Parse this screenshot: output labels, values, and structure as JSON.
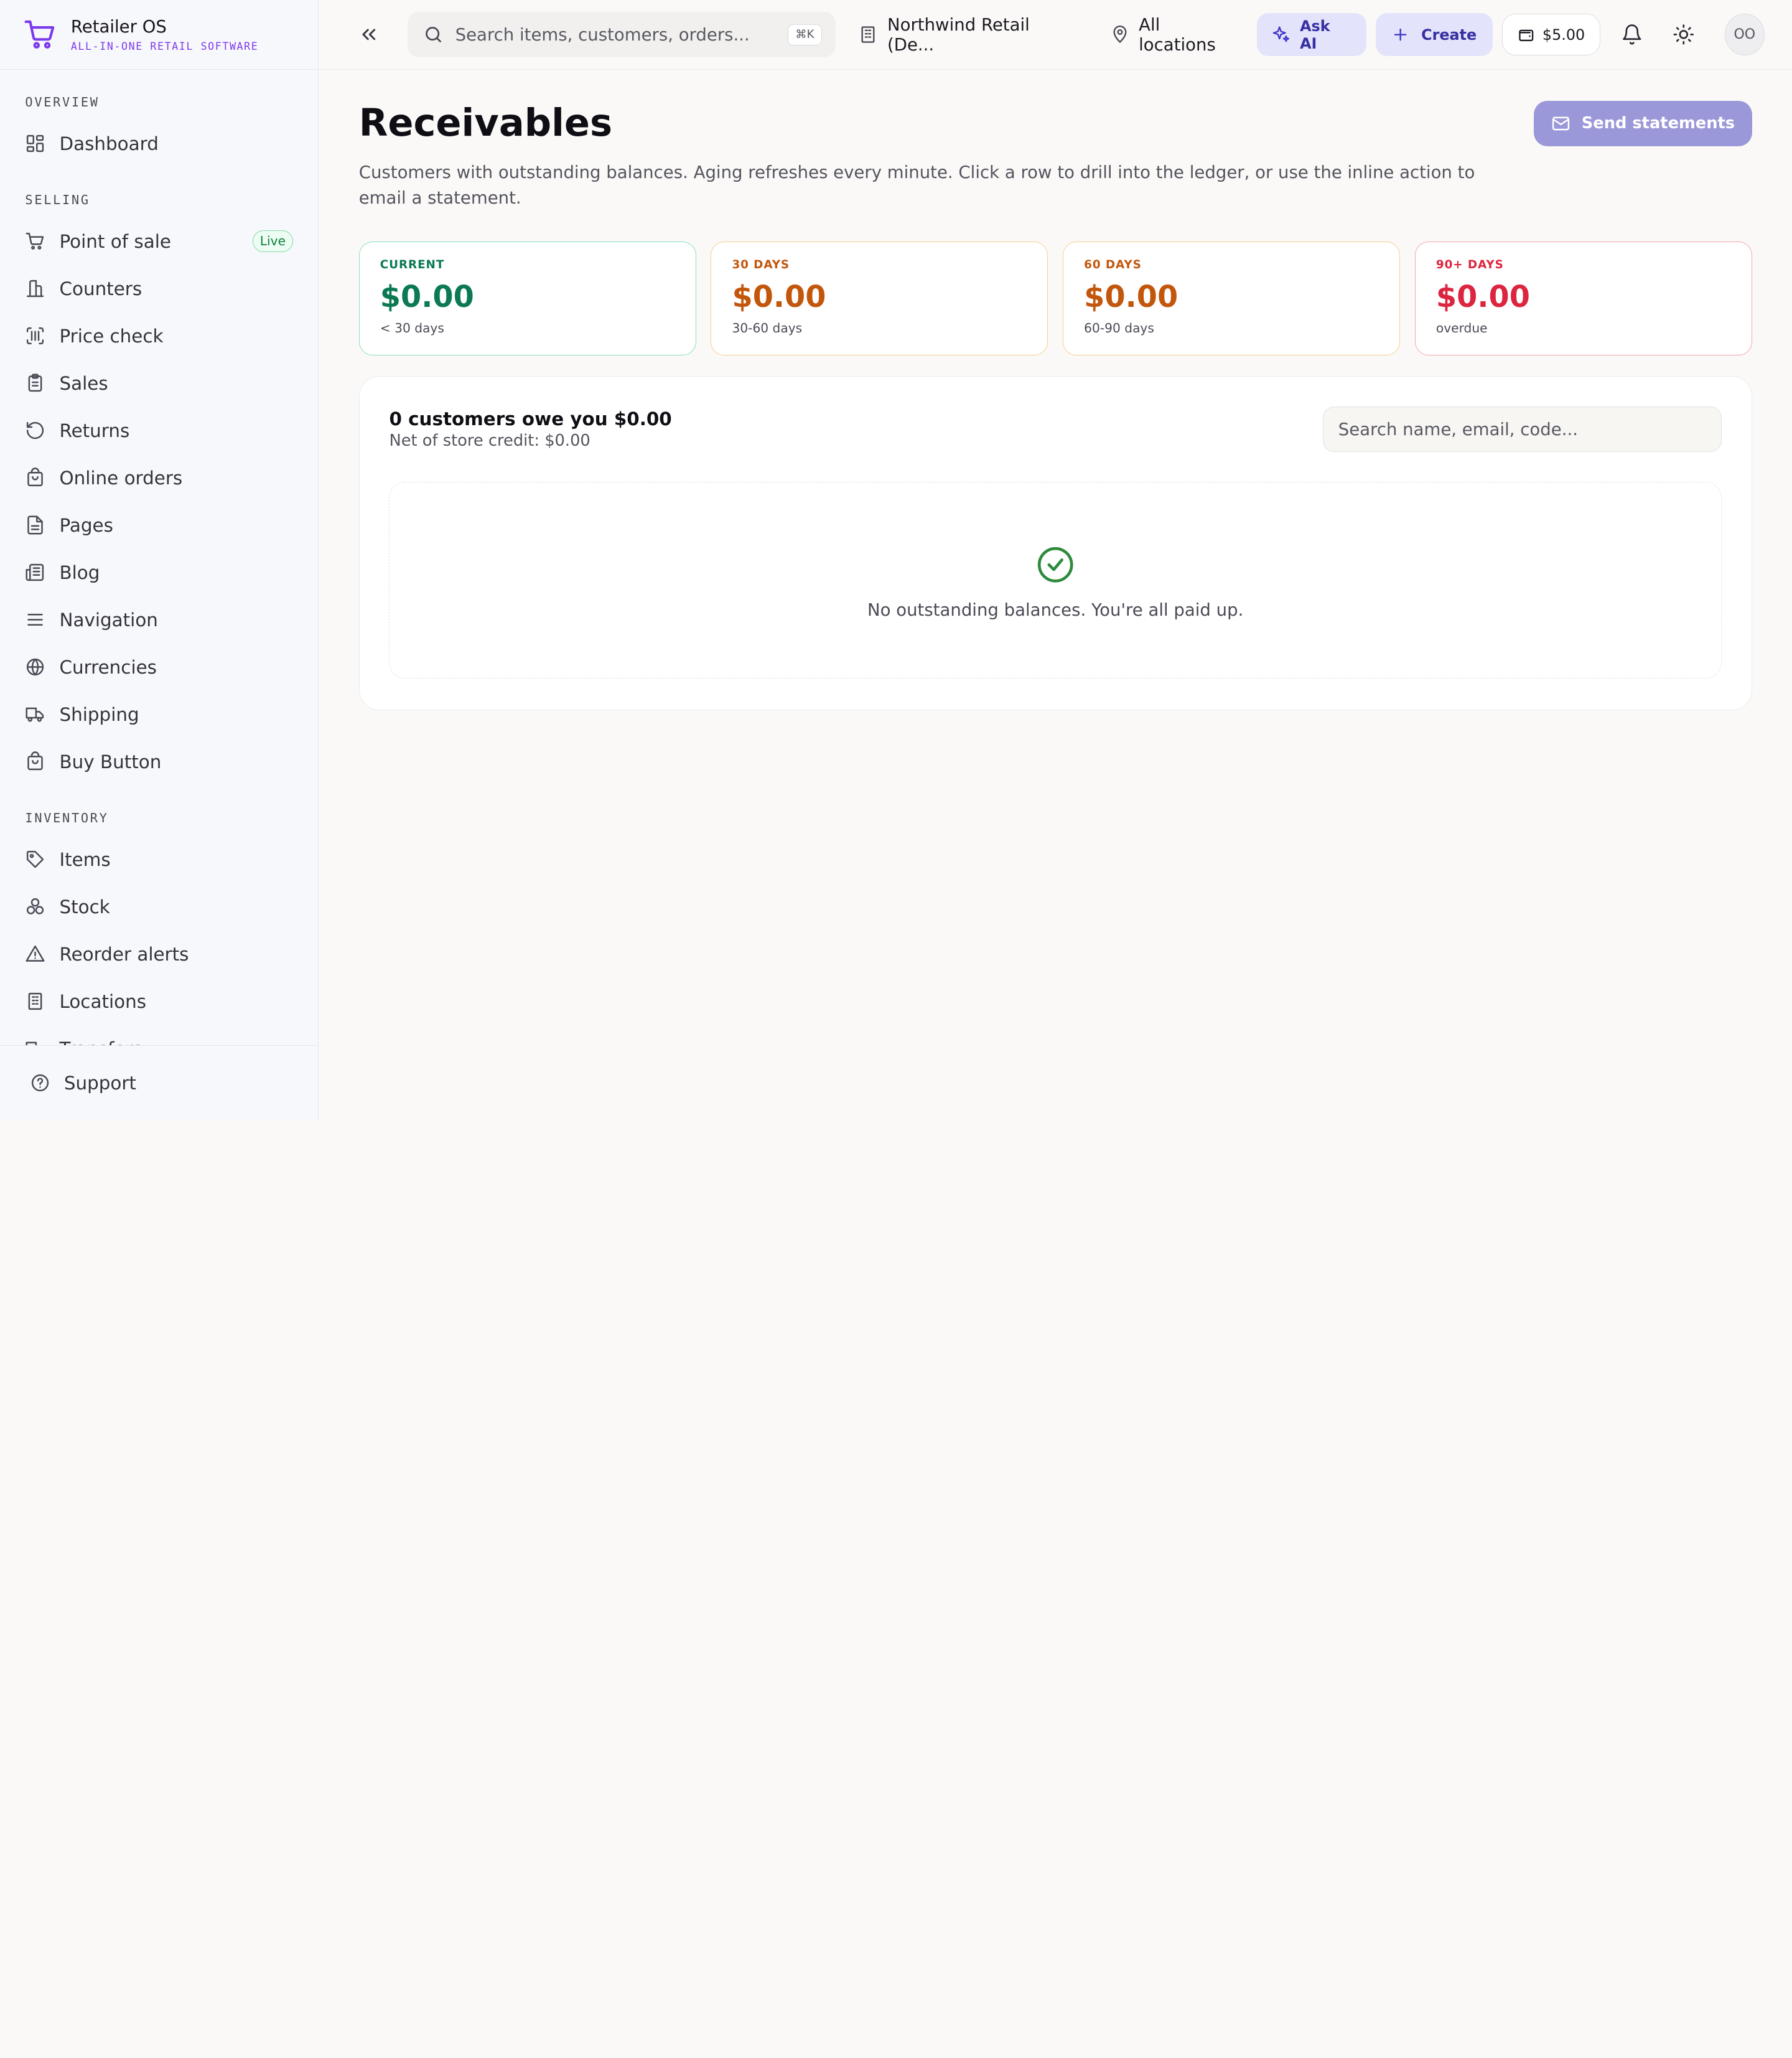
{
  "brand": {
    "name": "Retailer OS",
    "tagline": "ALL-IN-ONE RETAIL SOFTWARE"
  },
  "sidebar": {
    "sections": [
      {
        "title": "OVERVIEW",
        "items": [
          {
            "label": "Dashboard",
            "icon": "dashboard-icon"
          }
        ]
      },
      {
        "title": "SELLING",
        "items": [
          {
            "label": "Point of sale",
            "icon": "cart-icon",
            "badge": "Live"
          },
          {
            "label": "Counters",
            "icon": "counter-icon"
          },
          {
            "label": "Price check",
            "icon": "barcode-icon"
          },
          {
            "label": "Sales",
            "icon": "clipboard-icon"
          },
          {
            "label": "Returns",
            "icon": "returns-icon"
          },
          {
            "label": "Online orders",
            "icon": "bag-icon"
          },
          {
            "label": "Pages",
            "icon": "page-icon"
          },
          {
            "label": "Blog",
            "icon": "newspaper-icon"
          },
          {
            "label": "Navigation",
            "icon": "menu-icon"
          },
          {
            "label": "Currencies",
            "icon": "globe-icon"
          },
          {
            "label": "Shipping",
            "icon": "truck-icon"
          },
          {
            "label": "Buy Button",
            "icon": "bag-icon"
          }
        ]
      },
      {
        "title": "INVENTORY",
        "items": [
          {
            "label": "Items",
            "icon": "tag-icon"
          },
          {
            "label": "Stock",
            "icon": "boxes-icon"
          },
          {
            "label": "Reorder alerts",
            "icon": "alert-icon"
          },
          {
            "label": "Locations",
            "icon": "building-icon"
          },
          {
            "label": "Transfers",
            "icon": "truck-icon"
          }
        ]
      }
    ],
    "footer": {
      "label": "Support",
      "icon": "help-icon"
    }
  },
  "topbar": {
    "search_placeholder": "Search items, customers, orders...",
    "search_shortcut": "⌘K",
    "org": "Northwind Retail (De...",
    "location": "All locations",
    "ask_ai": "Ask AI",
    "create": "Create",
    "wallet": "$5.00",
    "avatar": "OO"
  },
  "page": {
    "title": "Receivables",
    "description": "Customers with outstanding balances. Aging refreshes every minute. Click a row to drill into the ledger, or use the inline action to email a statement.",
    "send_button": "Send statements"
  },
  "aging_cards": [
    {
      "label": "CURRENT",
      "value": "$0.00",
      "sub": "< 30 days",
      "status_color": "#0b7a53"
    },
    {
      "label": "30 DAYS",
      "value": "$0.00",
      "sub": "30-60 days",
      "status_color": "#c2570c"
    },
    {
      "label": "60 DAYS",
      "value": "$0.00",
      "sub": "60-90 days",
      "status_color": "#c2570c"
    },
    {
      "label": "90+ DAYS",
      "value": "$0.00",
      "sub": "overdue",
      "status_color": "#dc2640"
    }
  ],
  "panel": {
    "title": "0 customers owe you $0.00",
    "subtitle": "Net of store credit: $0.00",
    "search_placeholder": "Search name, email, code...",
    "empty_message": "No outstanding balances. You're all paid up."
  },
  "colors": {
    "brand_accent": "#7c3aed",
    "primary": "#4338ca",
    "send_button": "#9b98d9"
  }
}
